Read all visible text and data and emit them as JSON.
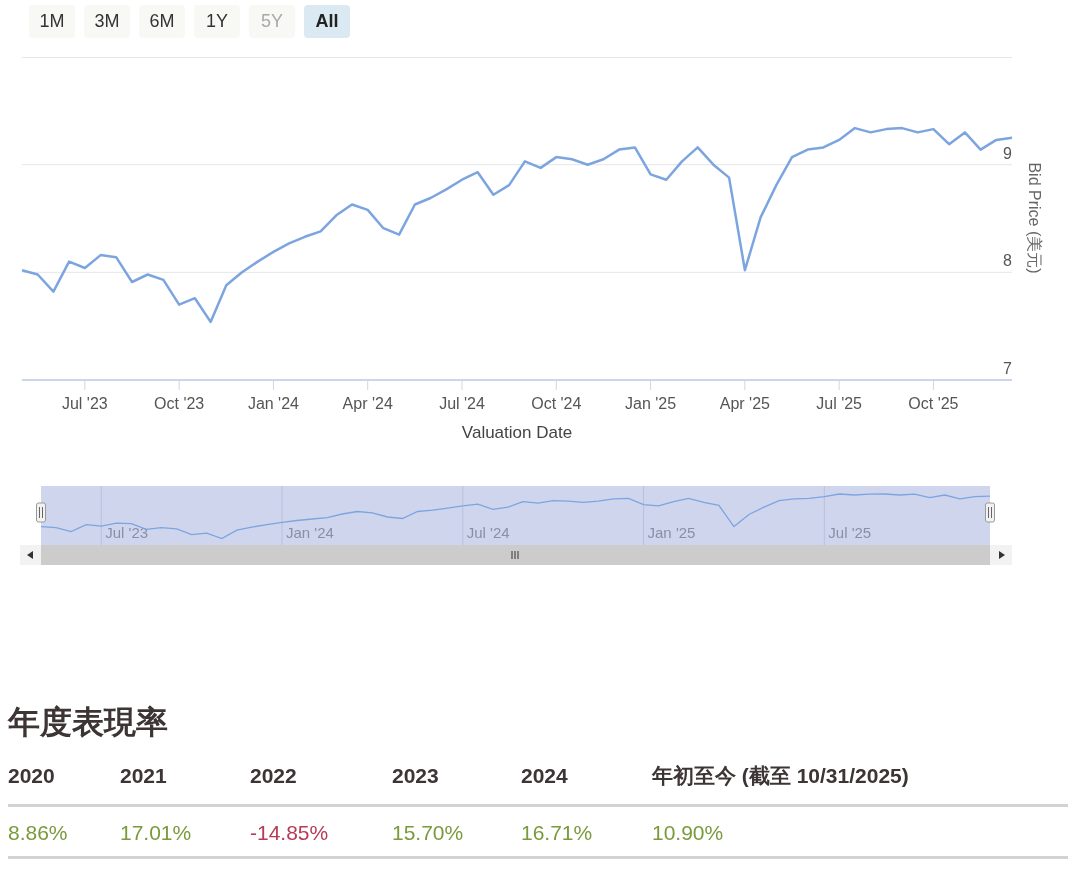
{
  "range_buttons": [
    {
      "label": "1M",
      "selected": false,
      "disabled": false
    },
    {
      "label": "3M",
      "selected": false,
      "disabled": false
    },
    {
      "label": "6M",
      "selected": false,
      "disabled": false
    },
    {
      "label": "1Y",
      "selected": false,
      "disabled": false
    },
    {
      "label": "5Y",
      "selected": false,
      "disabled": true
    },
    {
      "label": "All",
      "selected": true,
      "disabled": false
    }
  ],
  "chart": {
    "chart_data": {
      "type": "line",
      "xlabel": "Valuation Date",
      "ylabel": "Bid Price (美元)",
      "categories": [
        null,
        null,
        null,
        null,
        "Jul '23",
        null,
        null,
        null,
        null,
        null,
        "Oct '23",
        null,
        null,
        null,
        null,
        null,
        "Jan '24",
        null,
        null,
        null,
        null,
        null,
        "Apr '24",
        null,
        null,
        null,
        null,
        null,
        "Jul '24",
        null,
        null,
        null,
        null,
        null,
        "Oct '24",
        null,
        null,
        null,
        null,
        null,
        "Jan '25",
        null,
        null,
        null,
        null,
        null,
        "Apr '25",
        null,
        null,
        null,
        null,
        null,
        "Jul '25",
        null,
        null,
        null,
        null,
        null,
        "Oct '25",
        null,
        null,
        null,
        null,
        null
      ],
      "series": [
        {
          "color": "#7ca5e0",
          "values": [
            8.02,
            7.98,
            7.82,
            8.1,
            8.04,
            8.16,
            8.14,
            7.91,
            7.98,
            7.93,
            7.7,
            7.76,
            7.54,
            7.88,
            8.0,
            8.1,
            8.19,
            8.27,
            8.33,
            8.38,
            8.53,
            8.63,
            8.58,
            8.41,
            8.35,
            8.63,
            8.69,
            8.77,
            8.86,
            8.93,
            8.72,
            8.81,
            9.03,
            8.97,
            9.07,
            9.05,
            9.0,
            9.05,
            9.14,
            9.16,
            8.91,
            8.86,
            9.03,
            9.16,
            9.0,
            8.88,
            8.02,
            8.51,
            8.81,
            9.07,
            9.14,
            9.16,
            9.23,
            9.34,
            9.3,
            9.33,
            9.34,
            9.3,
            9.33,
            9.19,
            9.3,
            9.14,
            9.23,
            9.25
          ]
        }
      ],
      "ylim": [
        7,
        10
      ],
      "yticks": [
        7,
        8,
        9
      ]
    }
  },
  "navigator": {
    "ticks": [
      "Jul '23",
      "Jan '24",
      "Jul '24",
      "Jan '25",
      "Jul '25"
    ]
  },
  "performance": {
    "title": "年度表現率",
    "columns": [
      "2020",
      "2021",
      "2022",
      "2023",
      "2024",
      "年初至今 (截至 10/31/2025)"
    ],
    "values": [
      {
        "text": "8.86%",
        "color": "#7a9a3c"
      },
      {
        "text": "17.01%",
        "color": "#7a9a3c"
      },
      {
        "text": "-14.85%",
        "color": "#b73a57"
      },
      {
        "text": "15.70%",
        "color": "#7a9a3c"
      },
      {
        "text": "16.71%",
        "color": "#7a9a3c"
      },
      {
        "text": "10.90%",
        "color": "#7a9a3c"
      }
    ]
  }
}
